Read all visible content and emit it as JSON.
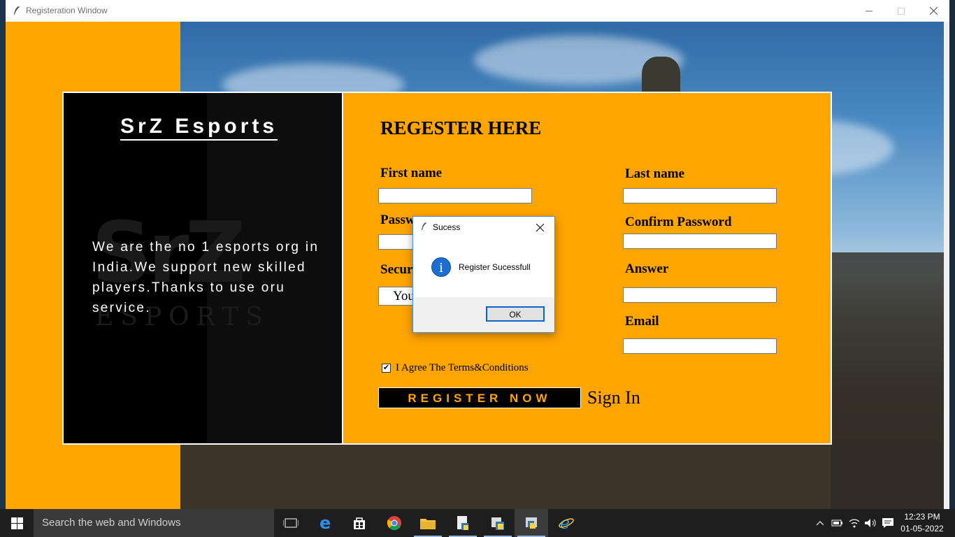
{
  "window": {
    "title": "Registeration Window"
  },
  "brand": {
    "name": "SrZ Esports",
    "about": "We are the no 1 esports org in India.We support new skilled players.Thanks to use oru service."
  },
  "form": {
    "heading": "REGESTER HERE",
    "first_name_label": "First name",
    "last_name_label": "Last name",
    "password_label": "Passw",
    "confirm_password_label": "Confirm Password",
    "security_label": "Secur",
    "security_value": "You",
    "answer_label": "Answer",
    "email_label": "Email",
    "terms_label": "I Agree The Terms&Conditions",
    "terms_checked": true,
    "register_button": "REGISTER NOW",
    "signin_link": "Sign In"
  },
  "dialog": {
    "title": "Sucess",
    "message": "Register Sucessfull",
    "ok": "OK"
  },
  "taskbar": {
    "search_placeholder": "Search the web and Windows",
    "time": "12:23 PM",
    "date": "01-05-2022"
  },
  "colors": {
    "accent": "#ffa500",
    "panel": "#000000",
    "dialog_border": "#4a90d9"
  }
}
